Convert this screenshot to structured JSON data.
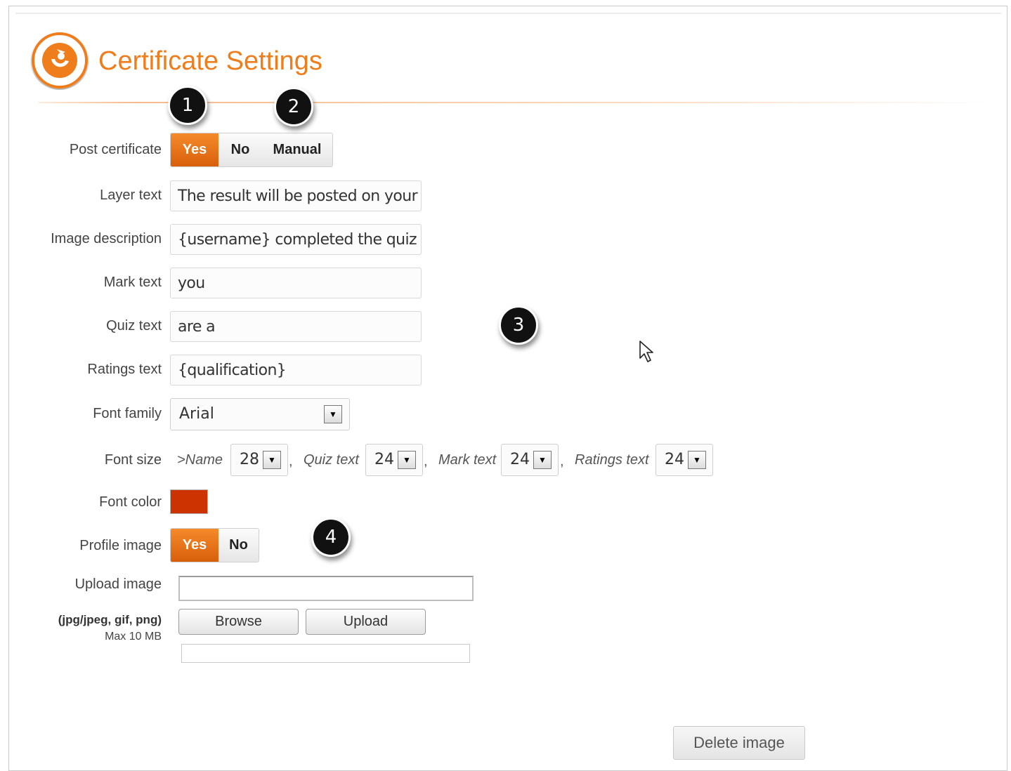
{
  "header": {
    "title": "Certificate Settings"
  },
  "post_certificate": {
    "label": "Post certificate",
    "options": [
      "Yes",
      "No",
      "Manual"
    ],
    "selected": "Yes"
  },
  "layer_text": {
    "label": "Layer text",
    "value": "The result will be posted on your v"
  },
  "image_description": {
    "label": "Image description",
    "value": "{username} completed the quiz he"
  },
  "mark_text": {
    "label": "Mark text",
    "value": "you"
  },
  "quiz_text": {
    "label": "Quiz text",
    "value": "are a"
  },
  "ratings_text": {
    "label": "Ratings text",
    "value": "{qualification}"
  },
  "font_family": {
    "label": "Font family",
    "value": "Arial"
  },
  "font_size": {
    "label": "Font size",
    "name_label": ">Name",
    "name_value": "28",
    "quiz_label": "Quiz text",
    "quiz_value": "24",
    "mark_label": "Mark text",
    "mark_value": "24",
    "ratings_label": "Ratings text",
    "ratings_value": "24",
    "separator": ","
  },
  "font_color": {
    "label": "Font color",
    "color": "#cc3300"
  },
  "profile_image": {
    "label": "Profile image",
    "options": [
      "Yes",
      "No"
    ],
    "selected": "Yes"
  },
  "upload_image": {
    "label": "Upload image",
    "formats": "(jpg/jpeg, gif, png)",
    "max_size": "Max 10 MB",
    "browse_label": "Browse",
    "upload_label": "Upload"
  },
  "delete_image_label": "Delete image",
  "markers": [
    "1",
    "2",
    "3",
    "4"
  ],
  "colors": {
    "accent": "#ef7d1b",
    "selected_button": "#e8711a"
  }
}
